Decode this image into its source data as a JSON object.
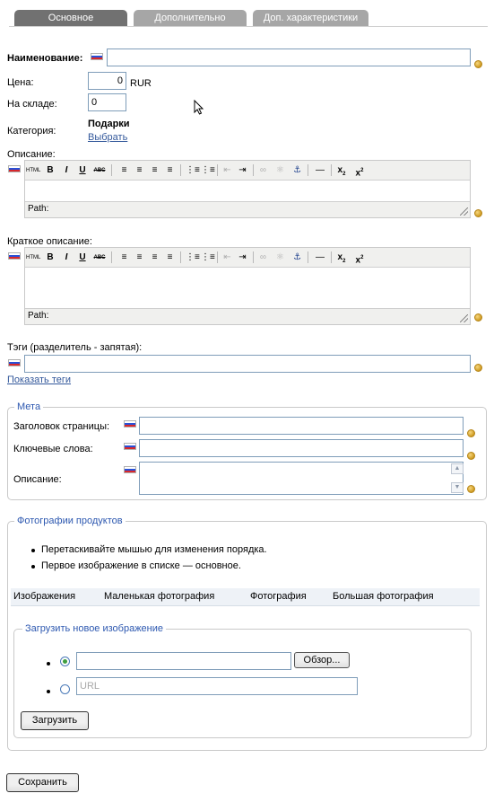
{
  "tabs": [
    {
      "label": "Основное",
      "active": true
    },
    {
      "label": "Дополнительно",
      "active": false
    },
    {
      "label": "Доп. характеристики",
      "active": false
    }
  ],
  "form": {
    "name_label": "Наименование:",
    "name_value": "",
    "price_label": "Цена:",
    "price_value": "0",
    "currency": "RUR",
    "stock_label": "На складе:",
    "stock_value": "0",
    "category_label": "Категория:",
    "category_value": "Подарки",
    "category_choose": "Выбрать",
    "description_label": "Описание:",
    "short_description_label": "Краткое описание:",
    "tags_label": "Тэги (разделитель - запятая):",
    "tags_value": "",
    "show_tags": "Показать теги"
  },
  "editor": {
    "html_label": "HTML",
    "bold": "B",
    "italic": "I",
    "underline": "U",
    "strike": "ABC",
    "path_label": "Path:"
  },
  "meta": {
    "legend": "Мета",
    "page_title_label": "Заголовок страницы:",
    "keywords_label": "Ключевые слова:",
    "description_label": "Описание:"
  },
  "photos": {
    "legend": "Фотографии продуктов",
    "hints": [
      "Перетаскивайте мышью для изменения порядка.",
      "Первое изображение в списке — основное."
    ],
    "columns": [
      "Изображения",
      "Маленькая фотография",
      "Фотография",
      "Большая фотография"
    ],
    "upload": {
      "legend": "Загрузить новое изображение",
      "browse_button": "Обзор...",
      "url_placeholder": "URL",
      "submit_button": "Загрузить"
    }
  },
  "save_button": "Сохранить",
  "colors": {
    "tab_active": "#717171",
    "tab_inactive": "#a6a6a6",
    "legend_text": "#2d58b0",
    "link": "#33589b"
  }
}
